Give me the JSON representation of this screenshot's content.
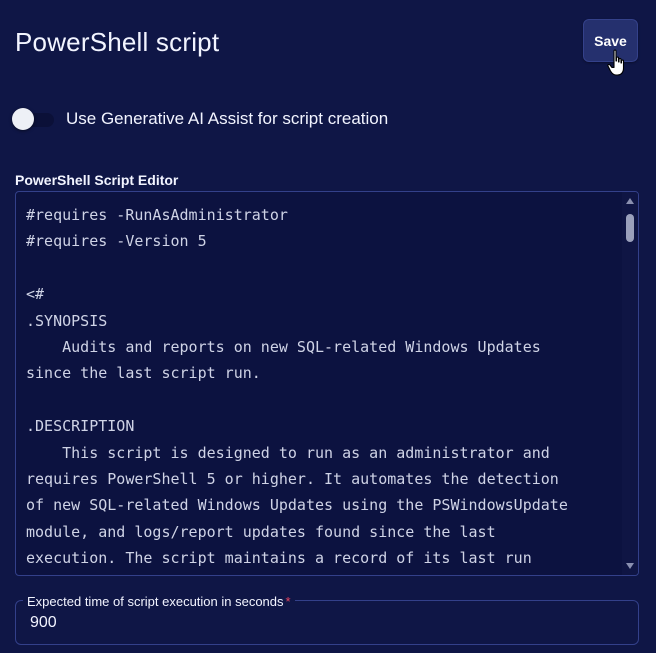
{
  "header": {
    "title": "PowerShell script",
    "save_label": "Save"
  },
  "ai_assist": {
    "label": "Use Generative AI Assist for script creation",
    "enabled": false
  },
  "editor": {
    "label": "PowerShell Script Editor",
    "code": "#requires -RunAsAdministrator\n#requires -Version 5\n\n<#\n.SYNOPSIS\n    Audits and reports on new SQL-related Windows Updates\nsince the last script run.\n\n.DESCRIPTION\n    This script is designed to run as an administrator and\nrequires PowerShell 5 or higher. It automates the detection\nof new SQL-related Windows Updates using the PSWindowsUpdate\nmodule, and logs/report updates found since the last\nexecution. The script maintains a record of its last run"
  },
  "execution_time": {
    "label": "Expected time of script execution in seconds",
    "required_mark": "*",
    "value": "900"
  },
  "icons": {
    "cursor": "hand-pointer-icon",
    "scroll_up": "scroll-up-arrow-icon",
    "scroll_down": "scroll-down-arrow-icon"
  },
  "colors": {
    "background": "#0f1646",
    "save_button": "#25306e",
    "border": "#33408a",
    "required": "#e2435f"
  }
}
